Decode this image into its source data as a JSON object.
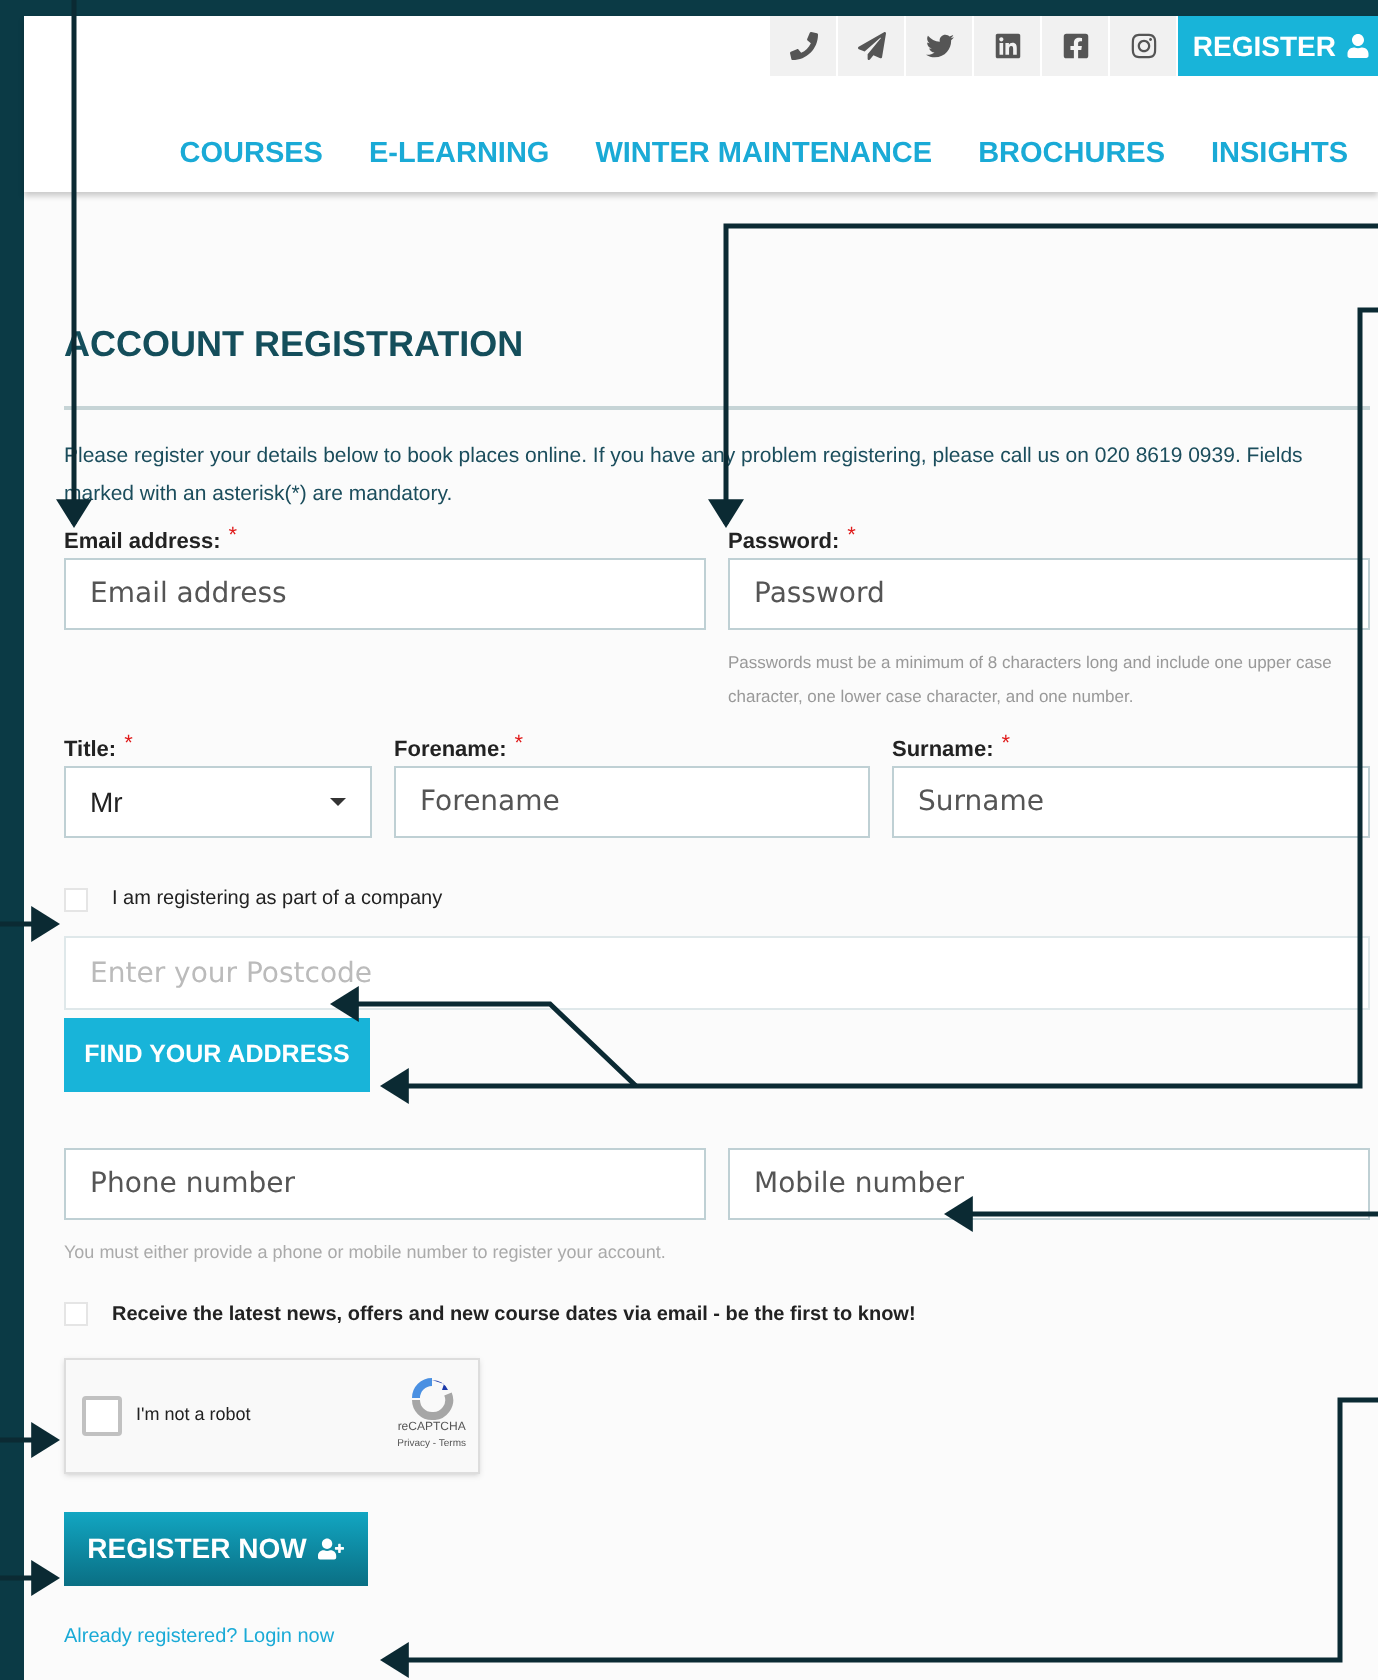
{
  "top_bar": {
    "register_button": "REGISTER"
  },
  "nav": [
    {
      "label": "COURSES"
    },
    {
      "label": "E-LEARNING"
    },
    {
      "label": "WINTER MAINTENANCE"
    },
    {
      "label": "BROCHURES"
    },
    {
      "label": "INSIGHTS"
    }
  ],
  "heading": "ACCOUNT REGISTRATION",
  "intro": "Please register your details below to book places online. If you have any problem registering, please call us on 020 8619 0939. Fields marked with an asterisk(*) are mandatory.",
  "email": {
    "label": "Email address:",
    "required_mark": "*",
    "placeholder": "Email address"
  },
  "password": {
    "label": "Password:",
    "required_mark": "*",
    "placeholder": "Password",
    "note": "Passwords must be a minimum of 8 characters long and include one upper case character, one lower case character, and one number."
  },
  "title": {
    "label": "Title:",
    "required_mark": "*",
    "value": "Mr"
  },
  "forename": {
    "label": "Forename:",
    "required_mark": "*",
    "placeholder": "Forename"
  },
  "surname": {
    "label": "Surname:",
    "required_mark": "*",
    "placeholder": "Surname"
  },
  "company_checkbox": {
    "label": "I am registering as part of a company",
    "checked": false
  },
  "postcode": {
    "placeholder": "Enter your Postcode"
  },
  "find_address_button": "FIND YOUR ADDRESS",
  "phone": {
    "placeholder": "Phone number"
  },
  "mobile": {
    "placeholder": "Mobile number"
  },
  "phone_note": "You must either provide a phone or mobile number to register your account.",
  "newsletter_checkbox": {
    "label": "Receive the latest news, offers and new course dates via email - be the first to know!",
    "checked": false
  },
  "captcha": {
    "label": "I'm not a robot",
    "checked": false,
    "brand": "reCAPTCHA",
    "links": "Privacy - Terms"
  },
  "register_now_button": "REGISTER NOW",
  "login_link": "Already registered? Login now"
}
